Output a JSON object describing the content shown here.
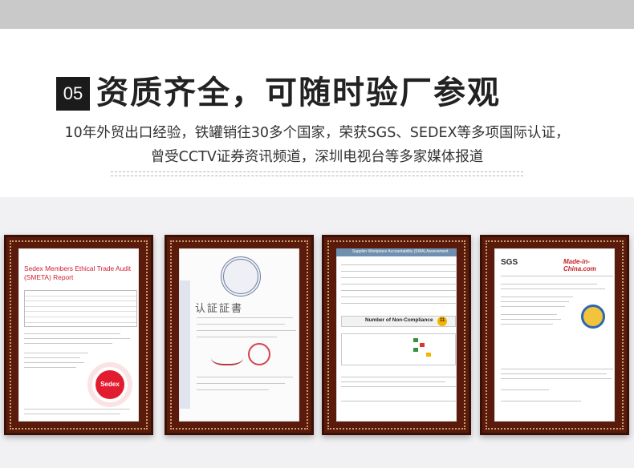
{
  "section": {
    "number": "05",
    "title": "资质齐全，可随时验厂参观",
    "line1": "10年外贸出口经验，铁罐销往30多个国家，荣获SGS、SEDEX等多项国际认证，",
    "line2": "曾受CCTV证券资讯频道，深圳电视台等多家媒体报道"
  },
  "certificates": [
    {
      "title_line1": "Sedex Members Ethical Trade Audit",
      "title_line2": "(SMETA) Report",
      "logo": "Sedex"
    },
    {
      "title": "认証証書"
    },
    {
      "header": "Supplier Workplace Accountability (SWA) Assessment",
      "box_label": "Number of Non-Compliance",
      "box_value": "11"
    },
    {
      "logo_left": "SGS",
      "logo_right": "Made-in-China.com"
    }
  ],
  "colors": {
    "frame": "#5b1b0c",
    "badge": "#1b1b1b",
    "sedex_red": "#e21b2e"
  }
}
